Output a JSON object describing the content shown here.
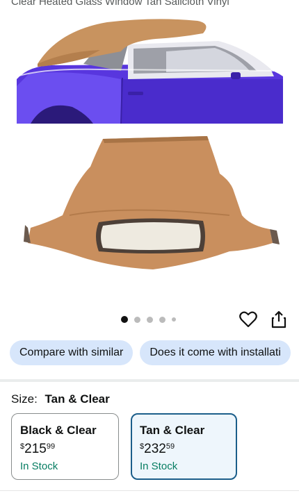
{
  "product": {
    "title_partial": "Clear Heated Glass Window Tan Sailcloth Vinyl"
  },
  "gallery": {
    "image_count": 5,
    "active_index": 0
  },
  "actions": {
    "wishlist_icon": "heart-icon",
    "share_icon": "share-icon"
  },
  "chips": [
    {
      "label": "Compare with similar"
    },
    {
      "label": "Does it come with installati"
    }
  ],
  "size": {
    "label": "Size:",
    "selected": "Tan & Clear",
    "options": [
      {
        "name": "Black & Clear",
        "currency": "$",
        "whole": "215",
        "fraction": "99",
        "stock": "In Stock"
      },
      {
        "name": "Tan & Clear",
        "currency": "$",
        "whole": "232",
        "fraction": "59",
        "stock": "In Stock"
      }
    ]
  },
  "colors": {
    "chip_bg": "#d7e6fb",
    "selected_border": "#1b5e8a",
    "stock_green": "#067d62",
    "tan": "#c98f5e",
    "car_blue": "#5b3fe0"
  }
}
